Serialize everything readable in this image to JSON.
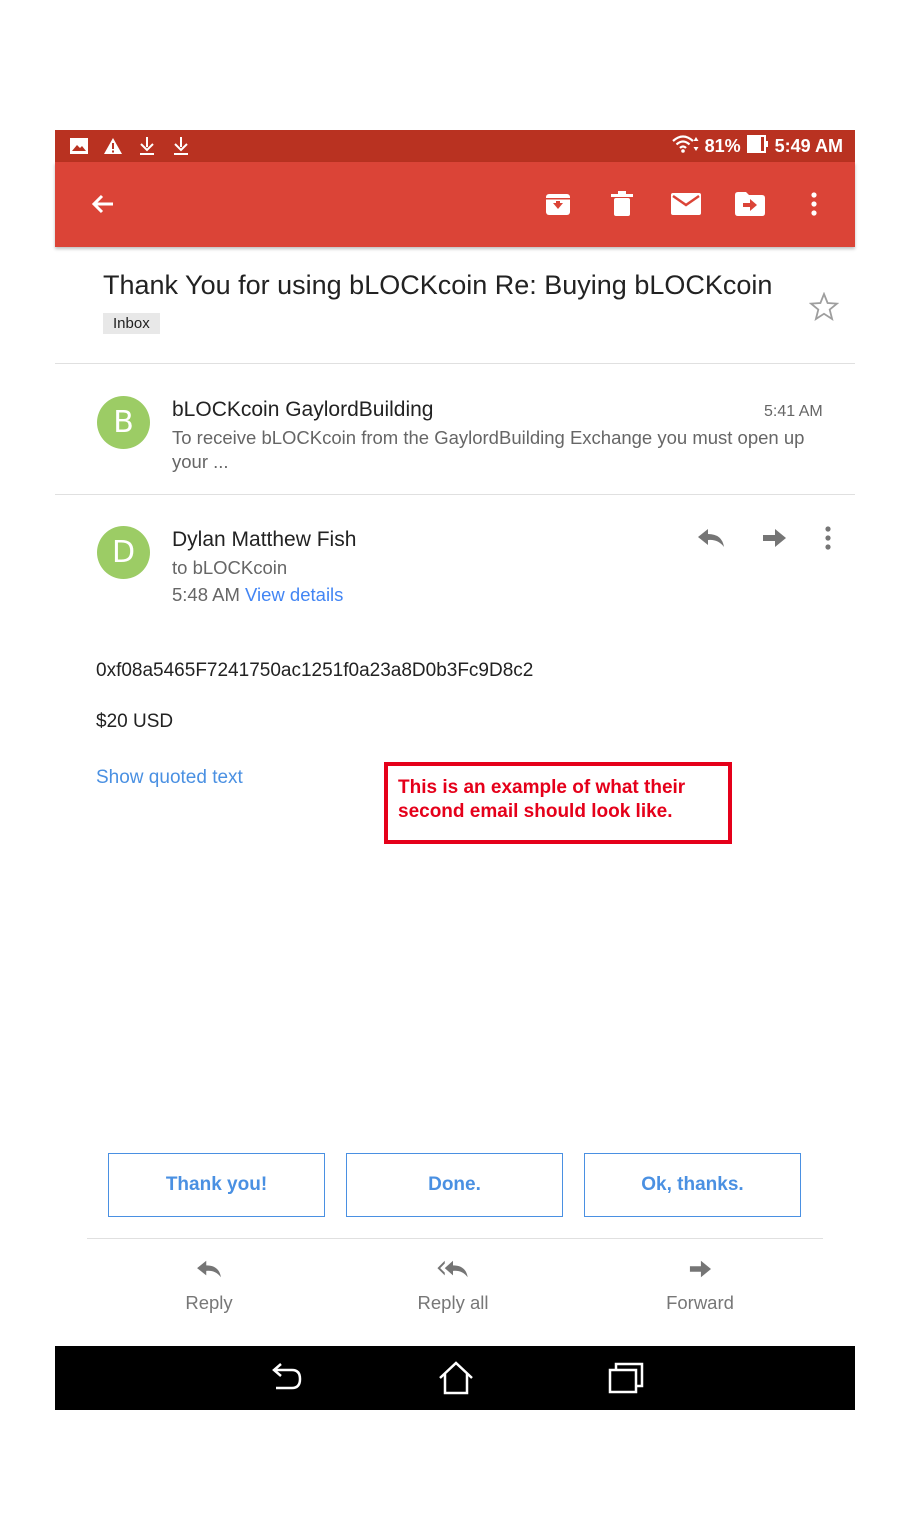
{
  "status_bar": {
    "battery": "81%",
    "time": "5:49 AM",
    "left_icons": [
      "image-icon",
      "warning-icon",
      "download-icon",
      "download-icon"
    ],
    "right_icons": [
      "wifi-icon",
      "battery-icon"
    ]
  },
  "app_bar": {
    "color": "#db4437",
    "back_icon": "arrow-left-icon",
    "actions": [
      "archive-icon",
      "trash-icon",
      "mail-icon",
      "move-folder-icon",
      "more-vert-icon"
    ]
  },
  "thread": {
    "subject": "Thank You for using bLOCKcoin Re: Buying bLOCKcoin",
    "label": "Inbox",
    "messages": [
      {
        "initial": "B",
        "sender": "bLOCKcoin GaylordBuilding",
        "time": "5:41 AM",
        "snippet": "To receive bLOCKcoin from the GaylordBuilding Exchange you must open up your ..."
      },
      {
        "initial": "D",
        "sender": "Dylan Matthew Fish",
        "to": "to bLOCKcoin",
        "time": "5:48 AM",
        "view_details": "View details",
        "body": [
          "0xf08a5465F7241750ac1251f0a23a8D0b3Fc9D8c2",
          "$20 USD"
        ],
        "show_quoted": "Show quoted text"
      }
    ]
  },
  "annotation": "This is an example of what their second email should look like.",
  "smart_replies": [
    "Thank you!",
    "Done.",
    "Ok, thanks."
  ],
  "bottom_actions": [
    "Reply",
    "Reply all",
    "Forward"
  ]
}
